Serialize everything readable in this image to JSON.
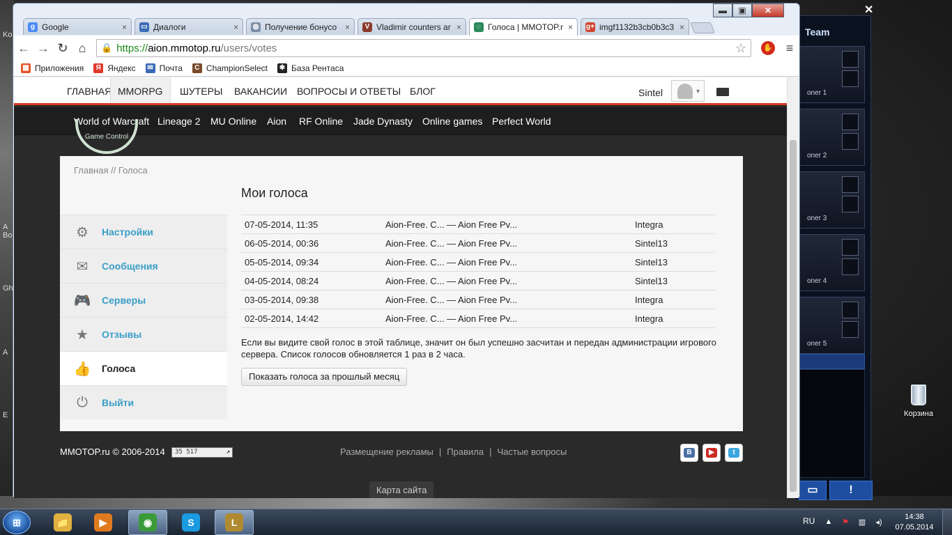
{
  "desktop": {
    "left_labels": [
      "Ko",
      "A",
      "Bo",
      "Gh",
      "A",
      "E"
    ],
    "lol_title": "Team",
    "lol_slots": [
      "oner 1",
      "oner 2",
      "oner 3",
      "oner 4",
      "oner 5"
    ],
    "recycle_bin_label": "Корзина",
    "lol_btn_chat": "",
    "lol_btn_alert": "!"
  },
  "browser": {
    "window_controls": {
      "minimize": "▬",
      "maximize": "▣",
      "close": "✕"
    },
    "tabs": [
      {
        "label": "Google",
        "icon": "google-icon",
        "icon_glyph": "g",
        "icon_color": "#4a8af4",
        "active": false
      },
      {
        "label": "Диалоги",
        "icon": "dialogs-icon",
        "icon_glyph": "▭",
        "icon_color": "#3b6bb5",
        "active": false
      },
      {
        "label": "Получение бонусо",
        "icon": "globe-icon",
        "icon_glyph": "◍",
        "icon_color": "#7a8ea8",
        "active": false
      },
      {
        "label": "Vladimir counters ar",
        "icon": "champion-icon",
        "icon_glyph": "V",
        "icon_color": "#8a3a2a",
        "active": false
      },
      {
        "label": "Голоса | MMOTOP.r",
        "icon": "loading-icon",
        "icon_glyph": "◌",
        "icon_color": "#2a8a5a",
        "active": true
      },
      {
        "label": "imgf1132b3cb0b3c3",
        "icon": "gplus-icon",
        "icon_glyph": "g+",
        "icon_color": "#d24530",
        "active": false
      }
    ],
    "tab_close": "×",
    "nav": {
      "back": "←",
      "forward": "→",
      "reload": "↻",
      "home": "⌂"
    },
    "url": {
      "proto": "https://",
      "host": "aion.mmotop.ru",
      "path": "/users/votes"
    },
    "star": "☆",
    "abp": "ABP",
    "menu": "≡",
    "bookmarks": [
      {
        "label": "Приложения",
        "icon": "apps-icon",
        "glyph": "▦",
        "color": "#e4572e"
      },
      {
        "label": "Яндекс",
        "icon": "yandex-icon",
        "glyph": "Я",
        "color": "#e03a2a"
      },
      {
        "label": "Почта",
        "icon": "mail-icon",
        "glyph": "✉",
        "color": "#3a6ab8"
      },
      {
        "label": "ChampionSelect",
        "icon": "championselect-icon",
        "glyph": "C",
        "color": "#7a4a2a"
      },
      {
        "label": "База Рентаса",
        "icon": "puzzle-icon",
        "glyph": "✱",
        "color": "#222222"
      }
    ]
  },
  "site": {
    "top_nav": [
      {
        "label": "ГЛАВНАЯ",
        "active": false
      },
      {
        "label": "MMORPG",
        "active": true
      },
      {
        "label": "ШУТЕРЫ",
        "active": false
      },
      {
        "label": "ВАКАНСИИ",
        "active": false
      },
      {
        "label": "ВОПРОСЫ И ОТВЕТЫ",
        "active": false
      },
      {
        "label": "БЛОГ",
        "active": false
      }
    ],
    "username": "Sintel",
    "sub_nav": [
      "World of Warcraft",
      "Lineage 2",
      "MU Online",
      "Aion",
      "RF Online",
      "Jade Dynasty",
      "Online games",
      "Perfect World"
    ],
    "logo_text": "Game Control",
    "breadcrumb": "Главная // Голоса",
    "side_menu": [
      {
        "label": "Настройки",
        "icon": "gear-icon",
        "glyph": "⚙",
        "active": false
      },
      {
        "label": "Сообщения",
        "icon": "envelope-icon",
        "glyph": "✉",
        "active": false
      },
      {
        "label": "Серверы",
        "icon": "gamepad-icon",
        "glyph": "🎮",
        "active": false
      },
      {
        "label": "Отзывы",
        "icon": "star-icon",
        "glyph": "★",
        "active": false
      },
      {
        "label": "Голоса",
        "icon": "thumbs-up-icon",
        "glyph": "👍",
        "active": true
      },
      {
        "label": "Выйти",
        "icon": "power-icon",
        "glyph": "⏻",
        "active": false
      }
    ],
    "heading": "Мои голоса",
    "votes": [
      {
        "date": "07-05-2014, 11:35",
        "server": "Aion-Free. C... — Aion Free Pv...",
        "user": "Integra"
      },
      {
        "date": "06-05-2014, 00:36",
        "server": "Aion-Free. C... — Aion Free Pv...",
        "user": "Sintel13"
      },
      {
        "date": "05-05-2014, 09:34",
        "server": "Aion-Free. C... — Aion Free Pv...",
        "user": "Sintel13"
      },
      {
        "date": "04-05-2014, 08:24",
        "server": "Aion-Free. C... — Aion Free Pv...",
        "user": "Sintel13"
      },
      {
        "date": "03-05-2014, 09:38",
        "server": "Aion-Free. C... — Aion Free Pv...",
        "user": "Integra"
      },
      {
        "date": "02-05-2014, 14:42",
        "server": "Aion-Free. C... — Aion Free Pv...",
        "user": "Integra"
      }
    ],
    "note": "Если вы видите свой голос в этой таблице, значит он был успешно засчитан и передан администрации игрового сервера. Список голосов обновляется 1 раз в 2 часа.",
    "prev_month_button": "Показать голоса за прошлый месяц",
    "footer": {
      "copyright": "MMOTOP.ru © 2006-2014",
      "counter": "35 517",
      "links": [
        "Размещение рекламы",
        "Правила",
        "Частые вопросы"
      ],
      "link_sep": "|",
      "social": [
        {
          "icon": "vk-icon",
          "glyph": "B",
          "color": "#4a6fa5"
        },
        {
          "icon": "youtube-icon",
          "glyph": "▶",
          "color": "#cc2a22"
        },
        {
          "icon": "twitter-icon",
          "glyph": "t",
          "color": "#3aa6e0"
        }
      ],
      "sitemap": "Карта сайта"
    }
  },
  "taskbar": {
    "start": "⊞",
    "apps": [
      {
        "icon": "explorer-icon",
        "glyph": "📁",
        "color": "#e0b040",
        "open": false
      },
      {
        "icon": "media-player-icon",
        "glyph": "▶",
        "color": "#e07a20",
        "open": false
      },
      {
        "icon": "chrome-icon",
        "glyph": "◉",
        "color": "#3a9a3a",
        "open": true
      },
      {
        "icon": "skype-icon",
        "glyph": "S",
        "color": "#1a9ae0",
        "open": false
      },
      {
        "icon": "lol-icon",
        "glyph": "L",
        "color": "#b08a30",
        "open": true
      }
    ],
    "lang": "RU",
    "time": "14:38",
    "date": "07.05.2014"
  }
}
